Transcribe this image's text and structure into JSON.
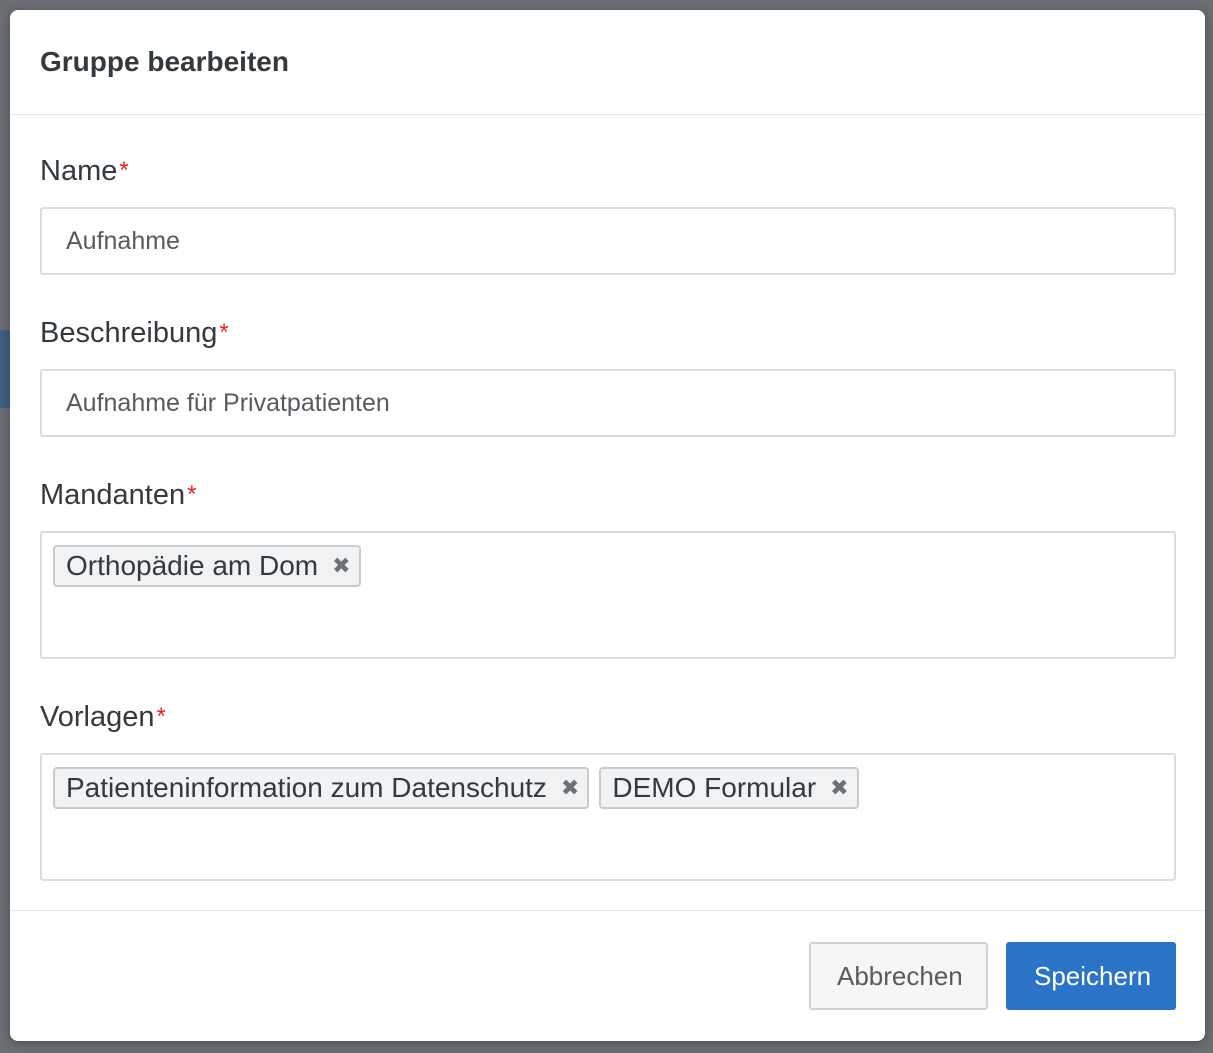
{
  "dialog": {
    "title": "Gruppe bearbeiten"
  },
  "form": {
    "required_marker": "*",
    "name": {
      "label": "Name",
      "value": "Aufnahme"
    },
    "description": {
      "label": "Beschreibung",
      "value": "Aufnahme für Privatpatienten"
    },
    "clients": {
      "label": "Mandanten",
      "tags": [
        "Orthopädie am Dom"
      ]
    },
    "templates": {
      "label": "Vorlagen",
      "tags": [
        "Patienteninformation zum Datenschutz",
        "DEMO Formular"
      ]
    }
  },
  "footer": {
    "cancel_label": "Abbrechen",
    "save_label": "Speichern"
  },
  "colors": {
    "primary": "#2a73c6",
    "required": "#e22424"
  },
  "icons": {
    "tag_remove": "close-icon"
  }
}
